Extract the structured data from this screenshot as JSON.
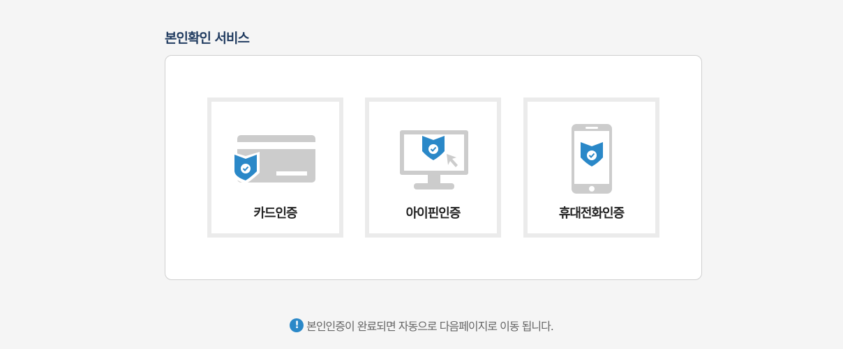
{
  "section": {
    "title": "본인확인 서비스"
  },
  "cards": [
    {
      "label": "카드인증",
      "icon": "credit-card-shield-icon"
    },
    {
      "label": "아이핀인증",
      "icon": "monitor-shield-icon"
    },
    {
      "label": "휴대전화인증",
      "icon": "phone-shield-icon"
    }
  ],
  "notice": {
    "icon": "!",
    "text": "본인인증이 완료되면 자동으로 다음페이지로 이동 됩니다."
  },
  "colors": {
    "accent": "#2a88c8",
    "icon_gray": "#cccccc",
    "title": "#1f3a5f"
  }
}
